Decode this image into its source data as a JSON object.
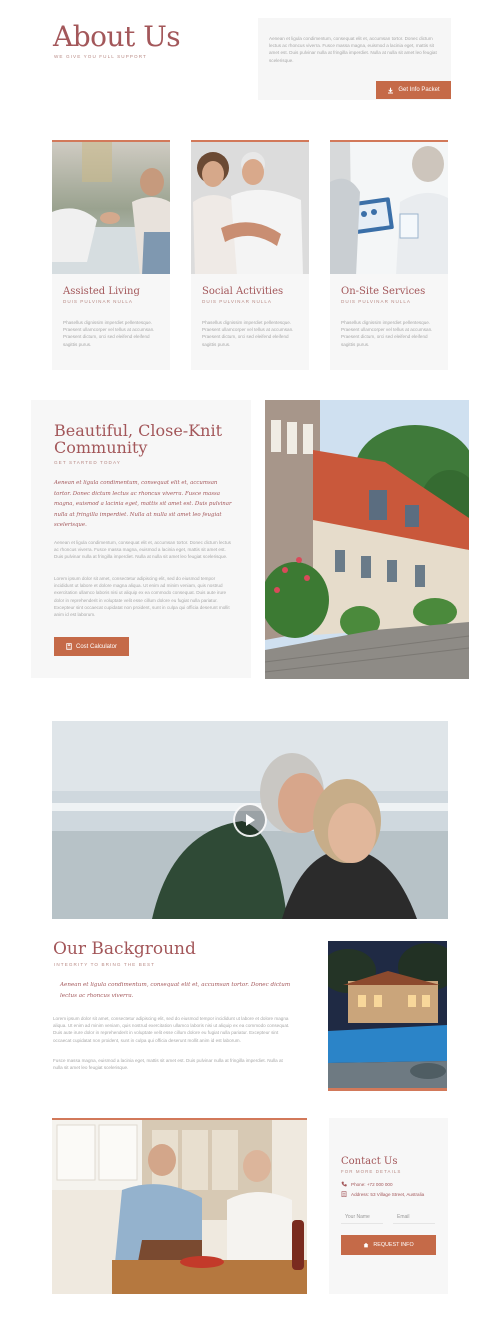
{
  "about": {
    "title": "About Us",
    "tagline": "WE GIVE YOU FULL SUPPORT",
    "intro": "Aenean et ligula condimentum, consequat elit et, accumsan tortor. Donec dictum lectus ac rhoncus viverra. Fusce massa magna, euismod a lacinia eget, mattis sit amet est. Duis pulvinar nulla at fringilla imperdiet. Nulla at nulla sit amet leo feugiat scelerisque.",
    "button": "Get Info Packet"
  },
  "services": [
    {
      "title": "Assisted Living",
      "sub": "DUIS PULVINAR NULLA",
      "text": "Phasellus dignissim imperdiet pellentesque. Praesent ullamcorper vel tellus at accumsan. Praesent dictum, orci sed eleifend eleifend sagittis purus."
    },
    {
      "title": "Social Activities",
      "sub": "DUIS PULVINAR NULLA",
      "text": "Phasellus dignissim imperdiet pellentesque. Praesent ullamcorper vel tellus at accumsan. Praesent dictum, orci sed eleifend eleifend sagittis purus."
    },
    {
      "title": "On-Site Services",
      "sub": "DUIS PULVINAR NULLA",
      "text": "Phasellus dignissim imperdiet pellentesque. Praesent ullamcorper vel tellus at accumsan. Praesent dictum, orci sed eleifend eleifend sagittis purus."
    }
  ],
  "community": {
    "title": "Beautiful, Close-Knit Community",
    "sub": "GET STARTED TODAY",
    "quote": "Aenean et ligula condimentum, consequat elit et, accumsan tortor. Donec dictum lectus ac rhoncus viverra. Fusce massa magna, euismod a lacinia eget, mattis sit amet est. Duis pulvinar nulla at fringilla imperdiet. Nulla at nulla sit amet leo feugiat scelerisque.",
    "para1": "Aenean et ligula condimentum, consequat elit et, accumsan tortor. Donec dictum lectus ac rhoncus viverra. Fusce massa magna, euismod a lacinia eget, mattis sit amet est. Duis pulvinar nulla at fringilla imperdiet. Nulla at nulla sit amet leo feugiat scelerisque.",
    "para2": "Lorem ipsum dolor sit amet, consectetur adipiscing elit, sed do eiusmod tempor incididunt ut labore et dolore magna aliqua. Ut enim ad minim veniam, quis nostrud exercitation ullamco laboris nisi ut aliquip ex ea commodo consequat. Duis aute irure dolor in reprehenderit in voluptate velit esse cillum dolore eu fugiat nulla pariatur. Excepteur sint occaecat cupidatat non proident, sunt in culpa qui officia deserunt mollit anim id est laborum.",
    "button": "Cost Calculator"
  },
  "background": {
    "title": "Our Background",
    "sub": "INTEGRITY TO BRING THE BEST",
    "quote": "Aenean et ligula condimentum, consequat elit et, accumsan tortor. Donec dictum lectus ac rhoncus viverra.",
    "para1": "Lorem ipsum dolor sit amet, consectetur adipiscing elit, sed do eiusmod tempor incididunt ut labore et dolore magna aliqua. Ut enim ad minim veniam, quis nostrud exercitation ullamco laboris nisi ut aliquip ex ea commodo consequat. Duis aute irure dolor in reprehenderit in voluptate velit esse cillum dolore eu fugiat nulla pariatur. Excepteur sint occaecat cupidatat non proident, sunt in culpa qui officia deserunt mollit anim id est laborum.",
    "para2": "Fusce massa magna, euismod a lacinia eget, mattis sit amet est. Duis pulvinar nulla at fringilla imperdiet. Nulla at nulla sit amet leo feugiat scelerisque."
  },
  "contact": {
    "title": "Contact Us",
    "sub": "FOR MORE DETAILS",
    "phone": "Phone: +72 000 000",
    "address": "Address: 53 Village Street, Australia",
    "name_placeholder": "Your Name",
    "email_placeholder": "Email",
    "button": "REQUEST INFO"
  },
  "colors": {
    "accent": "#a3575a",
    "button": "#c56a48",
    "card_border": "#d2795a",
    "panel": "#f7f7f7"
  },
  "icons": [
    "download-icon",
    "calculator-icon",
    "play-icon",
    "phone-icon",
    "address-icon",
    "home-icon"
  ]
}
